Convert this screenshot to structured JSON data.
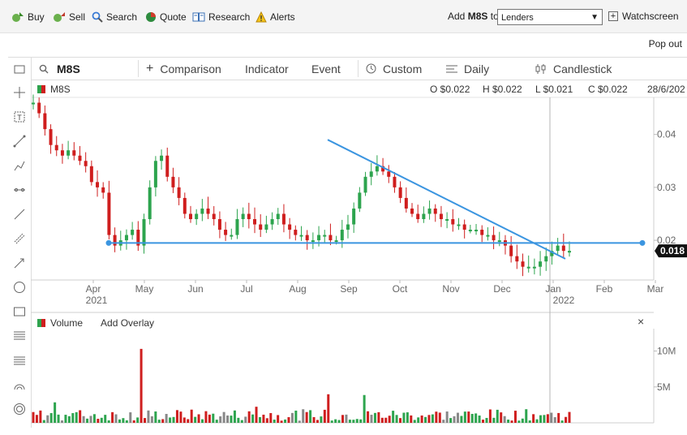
{
  "toolbar": {
    "buy": "Buy",
    "sell": "Sell",
    "search": "Search",
    "quote": "Quote",
    "research": "Research",
    "alerts": "Alerts",
    "add_prefix": "Add",
    "add_code": "M8S",
    "add_suffix": "to",
    "list_selected": "Lenders",
    "watchscreen": "Watchscreen"
  },
  "popout": "Pop out",
  "controls": {
    "symbol": "M8S",
    "comparison": "Comparison",
    "indicator": "Indicator",
    "event": "Event",
    "range": "Custom",
    "interval": "Daily",
    "chart_type": "Candlestick"
  },
  "legend": {
    "symbol": "M8S",
    "open": "O $0.022",
    "high": "H $0.022",
    "low": "L $0.021",
    "close": "C $0.022",
    "date": "28/6/202"
  },
  "volume": {
    "label": "Volume",
    "add_overlay": "Add Overlay",
    "close": "×"
  },
  "colors": {
    "up": "#2da44e",
    "down": "#cf1e1e",
    "neutral": "#888888",
    "trendline": "#3b95e0",
    "last_price_bg": "#111111"
  },
  "chart_data": {
    "type": "candlestick",
    "x_ticks": [
      "Apr",
      "May",
      "Jun",
      "Jul",
      "Aug",
      "Sep",
      "Oct",
      "Nov",
      "Dec",
      "Jan",
      "Feb",
      "Mar"
    ],
    "x_year_labels": [
      "2021",
      "2022"
    ],
    "y_ticks": [
      "0.04",
      "0.03",
      "0.02"
    ],
    "ylim": [
      0.0125,
      0.047
    ],
    "last_price": "0.018",
    "volume_ticks": [
      "10M",
      "5M"
    ],
    "volume_ylim": [
      0,
      13000000
    ],
    "price_series": [
      0.046,
      0.044,
      0.041,
      0.038,
      0.037,
      0.036,
      0.037,
      0.036,
      0.035,
      0.034,
      0.031,
      0.03,
      0.029,
      0.021,
      0.019,
      0.02,
      0.021,
      0.022,
      0.019,
      0.024,
      0.03,
      0.035,
      0.036,
      0.032,
      0.03,
      0.028,
      0.025,
      0.024,
      0.025,
      0.026,
      0.025,
      0.024,
      0.022,
      0.021,
      0.021,
      0.024,
      0.025,
      0.024,
      0.023,
      0.022,
      0.023,
      0.024,
      0.025,
      0.023,
      0.022,
      0.021,
      0.021,
      0.02,
      0.02,
      0.021,
      0.021,
      0.02,
      0.02,
      0.022,
      0.023,
      0.026,
      0.029,
      0.032,
      0.033,
      0.034,
      0.033,
      0.032,
      0.03,
      0.028,
      0.026,
      0.025,
      0.024,
      0.025,
      0.026,
      0.025,
      0.024,
      0.024,
      0.023,
      0.023,
      0.022,
      0.022,
      0.022,
      0.021,
      0.021,
      0.02,
      0.02,
      0.019,
      0.017,
      0.016,
      0.015,
      0.015,
      0.015,
      0.016,
      0.017,
      0.018,
      0.019,
      0.018,
      0.018
    ],
    "trendlines": [
      {
        "name": "support",
        "x_start": "2021-03-28",
        "x_end": "2022-03-05",
        "y_start": 0.0195,
        "y_end": 0.0195
      },
      {
        "name": "resistance",
        "x_start": "2021-08-28",
        "x_end": "2022-01-15",
        "y_start": 0.039,
        "y_end": 0.0165
      }
    ]
  }
}
